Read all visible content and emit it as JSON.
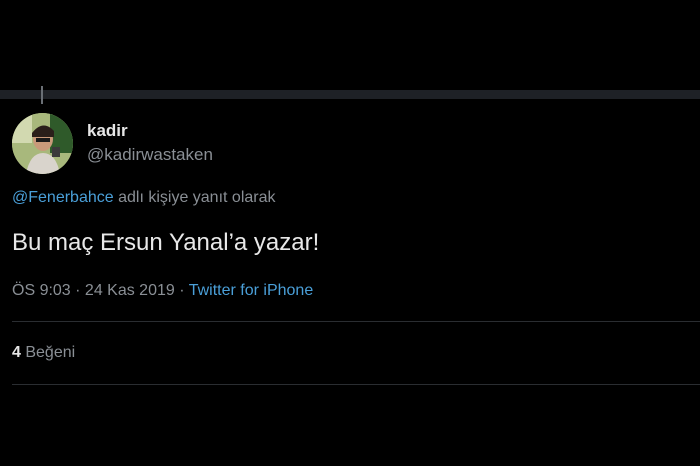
{
  "tweet": {
    "display_name": "kadir",
    "handle": "@kadirwastaken",
    "reply_mention": "@Fenerbahce",
    "reply_suffix": " adlı kişiye yanıt olarak",
    "text": "Bu maç Ersun Yanal’a yazar!",
    "time": "ÖS 9:03",
    "date_sep": " · ",
    "date": "24 Kas 2019",
    "source_sep": " · ",
    "source": "Twitter for iPhone",
    "like_count": "4",
    "like_label": " Beğeni"
  },
  "colors": {
    "background": "#000000",
    "link": "#4a9fd8",
    "muted": "#8a8f95"
  }
}
